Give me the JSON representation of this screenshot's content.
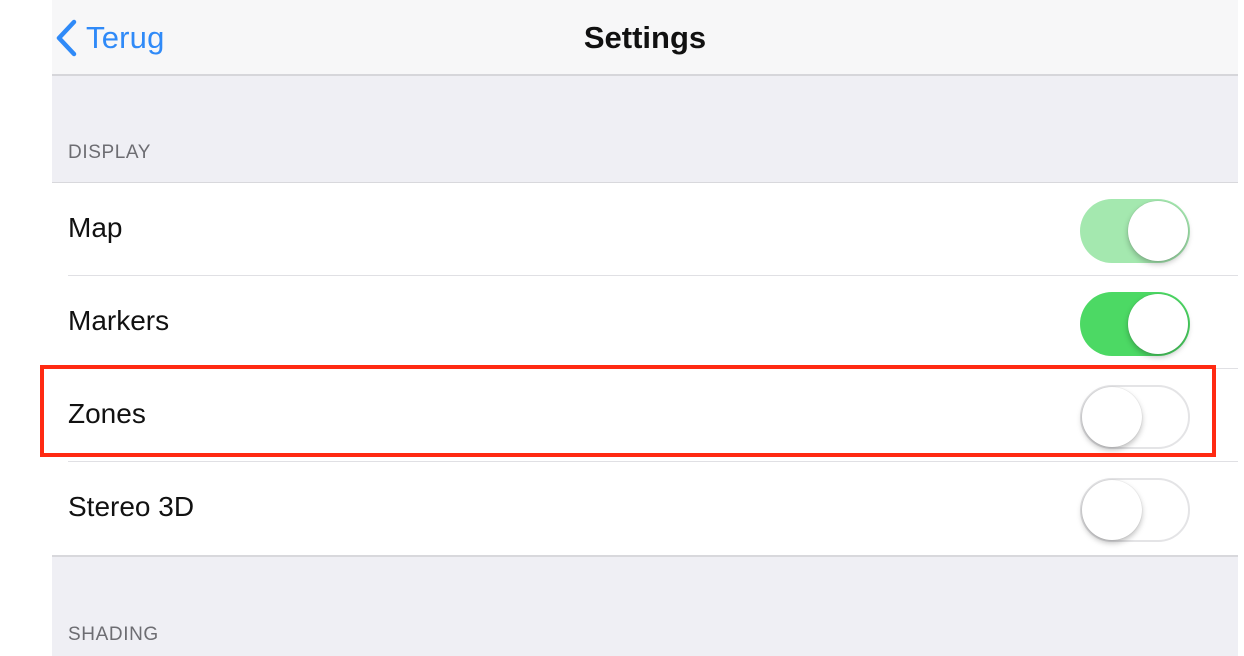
{
  "navbar": {
    "back_label": "Terug",
    "title": "Settings"
  },
  "sections": {
    "display_header": "DISPLAY",
    "shading_header": "SHADING"
  },
  "display_rows": [
    {
      "label": "Map",
      "toggle_on": true,
      "toggle_dimmed": true
    },
    {
      "label": "Markers",
      "toggle_on": true,
      "toggle_dimmed": false
    },
    {
      "label": "Zones",
      "toggle_on": false,
      "toggle_dimmed": false
    },
    {
      "label": "Stereo 3D",
      "toggle_on": false,
      "toggle_dimmed": false
    }
  ],
  "colors": {
    "accent_blue": "#2f8af8",
    "toggle_on_green": "#4cd964",
    "highlight_red": "#ff2a12",
    "grouped_background": "#efeff4"
  },
  "icons": {
    "back": "chevron-left-icon"
  }
}
